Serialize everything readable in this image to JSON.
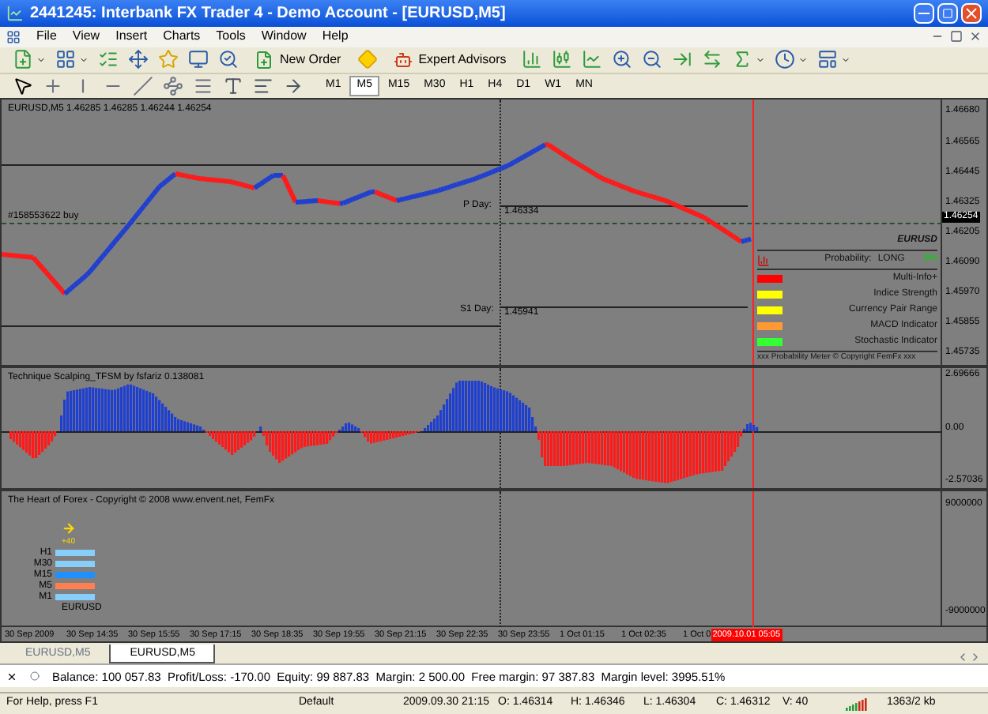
{
  "window": {
    "title": "2441245: Interbank FX Trader 4 - Demo Account - [EURUSD,M5]"
  },
  "menu": [
    "File",
    "View",
    "Insert",
    "Charts",
    "Tools",
    "Window",
    "Help"
  ],
  "toolbar": {
    "new_order": "New Order",
    "expert_advisors": "Expert Advisors"
  },
  "timeframes": [
    {
      "label": "M1",
      "selected": false
    },
    {
      "label": "M5",
      "selected": true
    },
    {
      "label": "M15",
      "selected": false
    },
    {
      "label": "M30",
      "selected": false
    },
    {
      "label": "H1",
      "selected": false
    },
    {
      "label": "H4",
      "selected": false
    },
    {
      "label": "D1",
      "selected": false
    },
    {
      "label": "W1",
      "selected": false
    },
    {
      "label": "MN",
      "selected": false
    }
  ],
  "main_chart": {
    "header": "EURUSD,M5  1.46285 1.46285 1.46244 1.46254",
    "order_label": "#158553622 buy",
    "p_day_label": "P Day:",
    "p_day_value": "1.46334",
    "s1_day_label": "S1 Day:",
    "s1_day_value": "1.45941",
    "price_axis": [
      "1.46680",
      "1.46565",
      "1.46445",
      "1.46325",
      "1.46205",
      "1.46090",
      "1.45970",
      "1.45855",
      "1.45735"
    ],
    "current_price": "1.46254"
  },
  "probability_meter": {
    "symbol": "EURUSD",
    "label": "Probability:",
    "direction": "LONG",
    "percent": "0%",
    "rows": [
      {
        "label": "Multi-Info+",
        "color": "#ff0000"
      },
      {
        "label": "Indice Strength",
        "color": "#ffff00"
      },
      {
        "label": "Currency Pair Range",
        "color": "#ffff00"
      },
      {
        "label": "MACD Indicator",
        "color": "#ff9933"
      },
      {
        "label": "Stochastic Indicator",
        "color": "#33ff33"
      }
    ],
    "footer": "xxx Probability Meter © Copyright FemFx xxx"
  },
  "indicator_1": {
    "title": "Technique Scalping_TFSM by fsfariz 0.138081",
    "axis": [
      "2.69666",
      "0.00",
      "-2.57036"
    ]
  },
  "indicator_2": {
    "title": "The Heart of Forex - Copyright © 2008 www.envent.net, FemFx",
    "arrow_label": "+40",
    "bars": [
      {
        "label": "H1",
        "color": "#87cefa"
      },
      {
        "label": "M30",
        "color": "#87cefa"
      },
      {
        "label": "M15",
        "color": "#1e90ff"
      },
      {
        "label": "M5",
        "color": "#ff7f50"
      },
      {
        "label": "M1",
        "color": "#87cefa"
      }
    ],
    "symbol": "EURUSD",
    "axis": [
      "9000000",
      "-9000000"
    ]
  },
  "time_axis": [
    "30 Sep 2009",
    "30 Sep 14:35",
    "30 Sep 15:55",
    "30 Sep 17:15",
    "30 Sep 18:35",
    "30 Sep 19:55",
    "30 Sep 21:15",
    "30 Sep 22:35",
    "30 Sep 23:55",
    "1 Oct 01:15",
    "1 Oct 02:35",
    "1 Oct 0"
  ],
  "time_marker": "2009.10.01 05:05",
  "tabs": [
    {
      "label": "EURUSD,M5",
      "selected": false
    },
    {
      "label": "EURUSD,M5",
      "selected": true
    }
  ],
  "terminal": {
    "summary": "Balance: 100 057.83  Profit/Loss: -170.00  Equity: 99 887.83  Margin: 2 500.00  Free margin: 97 387.83  Margin level: 3995.51%"
  },
  "status_bar": {
    "help": "For Help, press F1",
    "profile": "Default",
    "time": "2009.09.30 21:15",
    "open": "O: 1.46314",
    "high": "H: 1.46346",
    "low": "L: 1.46304",
    "close": "C: 1.46312",
    "volume": "V: 40",
    "traffic": "1363/2 kb"
  }
}
